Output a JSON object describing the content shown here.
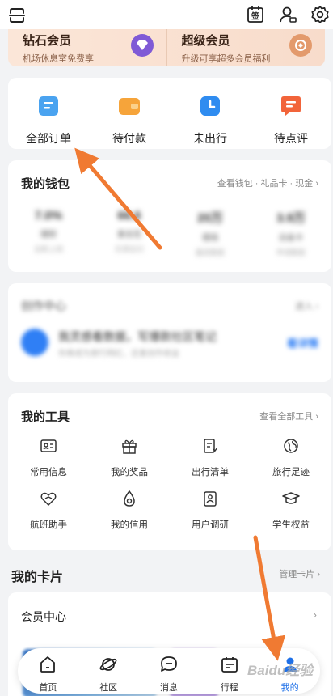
{
  "topbar": {
    "scan_icon": "scan-icon",
    "checkin_icon": "checkin-calendar-icon",
    "checkin_glyph": "签",
    "service_icon": "customer-service-icon",
    "settings_icon": "settings-gear-icon"
  },
  "membership": [
    {
      "title": "钻石会员",
      "desc": "机场休息室免费享",
      "badge_color": "#7f5ad6"
    },
    {
      "title": "超级会员",
      "desc": "升级可享超多会员福利",
      "badge_color": "#e39a6c"
    }
  ],
  "orders": [
    {
      "label": "全部订单",
      "icon": "all-orders-icon",
      "color": "#4aa3f0"
    },
    {
      "label": "待付款",
      "icon": "wallet-pending-payment-icon",
      "color": "#f6a43a"
    },
    {
      "label": "未出行",
      "icon": "clock-not-traveled-icon",
      "color": "#2f8cf0"
    },
    {
      "label": "待点评",
      "icon": "comment-pending-review-icon",
      "color": "#f2643a"
    }
  ],
  "wallet": {
    "title": "我的钱包",
    "links": "查看钱包 · 礼品卡 · 现金 ›",
    "stats": [
      {
        "value": "7.0%",
        "name": "理财",
        "sub": "全新上线"
      },
      {
        "value": "66.6",
        "name": "拿去花",
        "sub": "先享后付"
      },
      {
        "value": "20万",
        "name": "借钱",
        "sub": "最高额度"
      },
      {
        "value": "3.9万",
        "name": "白金卡",
        "sub": "申请额度"
      }
    ]
  },
  "creator": {
    "title": "创作中心",
    "entry": "进入 ›",
    "line1": "我灵感看数据，写爆款社区笔记",
    "line2": "你离成为旅行网红，还差创作收益",
    "button": "看详情"
  },
  "tools": {
    "title": "我的工具",
    "link": "查看全部工具 ›",
    "items": [
      {
        "label": "常用信息",
        "icon": "id-card-icon"
      },
      {
        "label": "我的奖品",
        "icon": "gift-icon"
      },
      {
        "label": "出行清单",
        "icon": "checklist-icon"
      },
      {
        "label": "旅行足迹",
        "icon": "globe-footprint-icon"
      },
      {
        "label": "航班助手",
        "icon": "heart-plane-icon"
      },
      {
        "label": "我的信用",
        "icon": "credit-drop-icon"
      },
      {
        "label": "用户调研",
        "icon": "survey-clipboard-icon"
      },
      {
        "label": "学生权益",
        "icon": "graduation-cap-icon"
      }
    ]
  },
  "cards_section": {
    "title": "我的卡片",
    "link": "管理卡片 ›"
  },
  "vip_card": {
    "title": "会员中心",
    "arrow": "›"
  },
  "tabbar": [
    {
      "label": "首页",
      "icon": "home-icon",
      "active": false
    },
    {
      "label": "社区",
      "icon": "planet-community-icon",
      "active": false
    },
    {
      "label": "消息",
      "icon": "message-bubble-icon",
      "active": false
    },
    {
      "label": "行程",
      "icon": "itinerary-calendar-icon",
      "active": false
    },
    {
      "label": "我的",
      "icon": "profile-person-icon",
      "active": true
    }
  ],
  "watermark": "Baidu经验",
  "colors": {
    "accent": "#1e70e8",
    "annotation_arrow": "#f07a32",
    "background": "#f2f3f5"
  }
}
